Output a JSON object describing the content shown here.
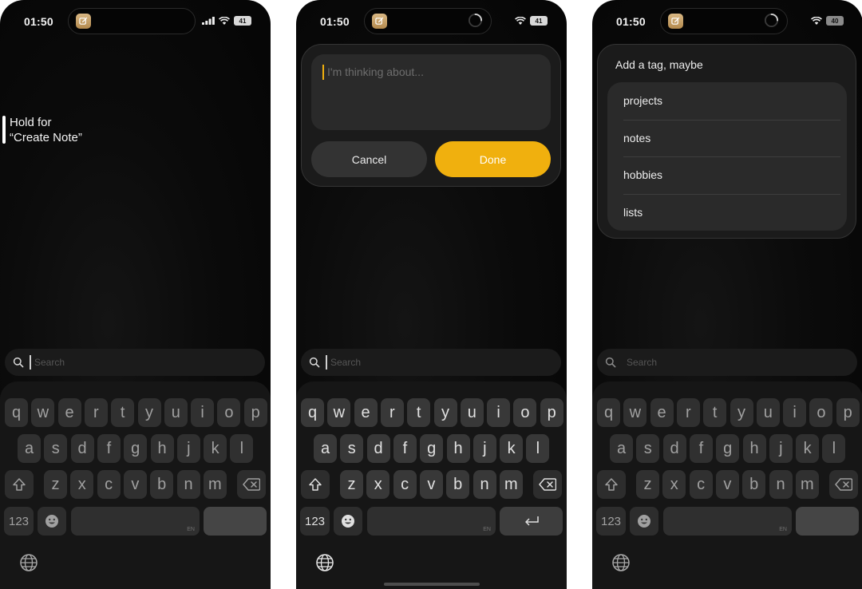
{
  "screens": [
    {
      "id": "screen-1",
      "status": {
        "time": "01:50",
        "battery": "41",
        "signal": true,
        "loading": false
      },
      "hint": {
        "text": "Hold for\n“Create Note”"
      },
      "search": {
        "placeholder": "Search",
        "focused": true
      },
      "keyboard": {
        "active": false,
        "space_label": "EN",
        "return": "empty"
      }
    },
    {
      "id": "screen-2",
      "status": {
        "time": "01:50",
        "battery": "41",
        "signal": false,
        "loading": true
      },
      "composer": {
        "placeholder": "I'm thinking about...",
        "cancel_label": "Cancel",
        "done_label": "Done"
      },
      "search": {
        "placeholder": "Search",
        "focused": true
      },
      "keyboard": {
        "active": true,
        "space_label": "EN",
        "return": "return-arrow"
      }
    },
    {
      "id": "screen-3",
      "status": {
        "time": "01:50",
        "battery": "40",
        "signal": false,
        "loading": true
      },
      "tags": {
        "title": "Add a tag, maybe",
        "items": [
          "projects",
          "notes",
          "hobbies",
          "lists"
        ]
      },
      "search": {
        "placeholder": "Search",
        "focused": false
      },
      "keyboard": {
        "active": false,
        "space_label": "EN",
        "return": "empty"
      }
    }
  ],
  "keyboard_keys": {
    "row1": [
      "q",
      "w",
      "e",
      "r",
      "t",
      "y",
      "u",
      "i",
      "o",
      "p"
    ],
    "row2": [
      "a",
      "s",
      "d",
      "f",
      "g",
      "h",
      "j",
      "k",
      "l"
    ],
    "row3": [
      "z",
      "x",
      "c",
      "v",
      "b",
      "n",
      "m"
    ],
    "numbers_label": "123",
    "shift_icon": "shift-icon",
    "delete_icon": "delete-icon",
    "emoji_icon": "emoji-icon",
    "globe_icon": "globe-icon"
  },
  "colors": {
    "accent": "#f0b00e",
    "background": "#0b0b0b",
    "card": "#1b1b1b",
    "key": "#383838"
  }
}
